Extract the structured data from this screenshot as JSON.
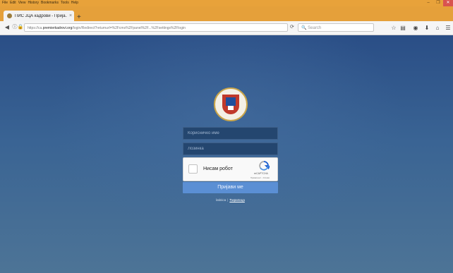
{
  "browser": {
    "menu": [
      "File",
      "Edit",
      "View",
      "History",
      "Bookmarks",
      "Tools",
      "Help"
    ],
    "window_controls": {
      "minimize": "–",
      "maximize": "❐",
      "close": "✕"
    },
    "tab": {
      "title": "ПИС ЈЦА кадрови - Прија...",
      "close": "×"
    },
    "new_tab": "+",
    "url": {
      "prefix": "https://ca.",
      "domain": "premierkadrovi.org",
      "rest": "/login/Redirect?returnurl=%2Fcms%2Fpanel%2F...%2Fsettings%2Flogin"
    },
    "search_placeholder": "Search",
    "icons": {
      "back": "back-icon",
      "info": "info-icon",
      "lock": "lock-icon",
      "reload": "reload-icon",
      "search": "search-icon",
      "bookmark": "star-icon",
      "library": "library-icon",
      "pocket": "pocket-icon",
      "download": "download-icon",
      "home": "home-icon",
      "menu": "hamburger-icon"
    }
  },
  "login": {
    "username_placeholder": "Корисничко име",
    "password_placeholder": "Лозинка",
    "captcha": {
      "label": "Нисам робот",
      "brand": "reCAPTCHA",
      "terms": "Приватност - Услови"
    },
    "submit_label": "Пријави ме",
    "language": {
      "first": "latinica",
      "separator": "|",
      "second": "Ћирилица"
    }
  },
  "colors": {
    "chrome_accent": "#e5a03a",
    "page_background": "#2b4f86",
    "submit_button": "#5b8fd4"
  }
}
